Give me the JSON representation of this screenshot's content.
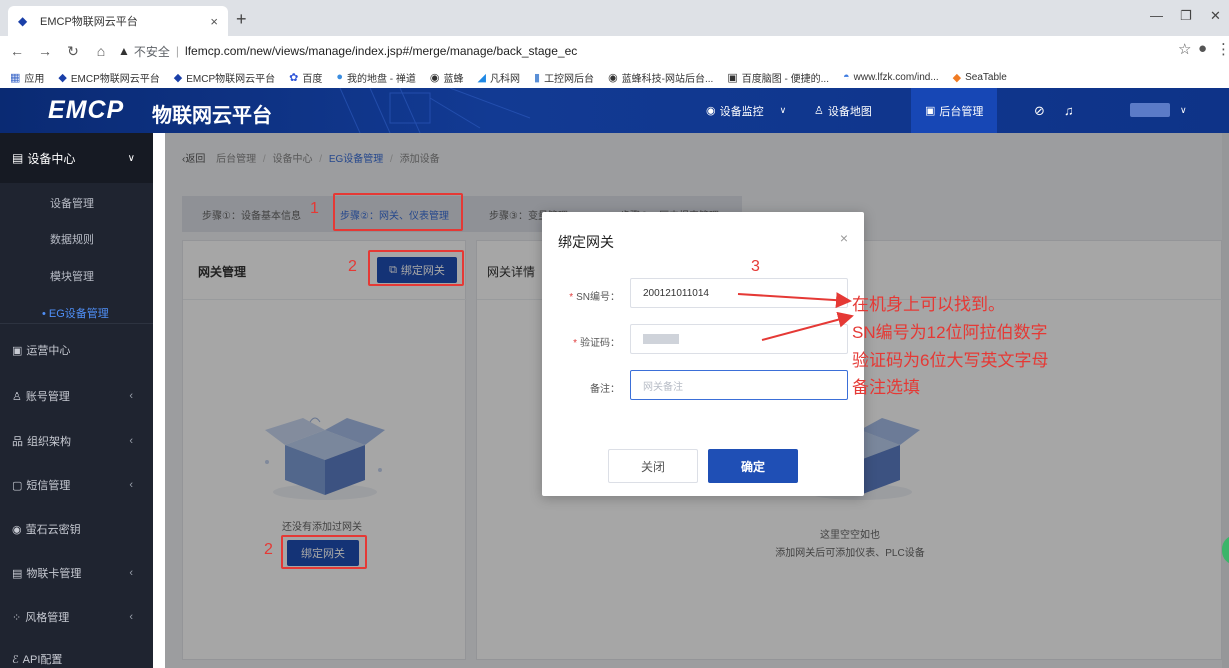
{
  "browser": {
    "tab_title": "EMCP物联网云平台",
    "tab_close": "×",
    "new_tab": "+",
    "insecure_label": "不安全",
    "url": "lfemcp.com/new/views/manage/index.jsp#/merge/manage/back_stage_ec",
    "bookmarks": [
      "应用",
      "EMCP物联网云平台",
      "EMCP物联网云平台",
      "百度",
      "我的地盘 - 禅道",
      "蓝蜂",
      "凡科网",
      "工控网后台",
      "蓝蜂科技-网站后台...",
      "百度脑图 - 便捷的...",
      "www.lfzk.com/ind...",
      "SeaTable"
    ]
  },
  "header": {
    "logo": "EMCP",
    "logo_sub": "物联网云平台",
    "nav": {
      "monitor": "设备监控",
      "monitor_caret": "∨",
      "map": "设备地图",
      "backend": "后台管理",
      "avatar_caret": "∨"
    }
  },
  "sidebar": {
    "head": "设备中心",
    "sub_items": [
      "设备管理",
      "数据规则",
      "模块管理",
      "EG设备管理"
    ],
    "items": [
      "运营中心",
      "账号管理",
      "组织架构",
      "短信管理",
      "萤石云密钥",
      "物联卡管理",
      "风格管理",
      "API配置"
    ]
  },
  "breadcrumb": {
    "back": "‹返回",
    "parts": [
      "后台管理",
      "设备中心",
      "EG设备管理",
      "添加设备"
    ]
  },
  "steps": [
    "步骤①：设备基本信息",
    "步骤②：网关、仪表管理",
    "步骤③：变量管理",
    "步骤④：历史报表管理"
  ],
  "panels": {
    "left_title": "网关管理",
    "bind_button": "绑定网关",
    "empty_text": "还没有添加过网关",
    "bind_button_2": "绑定网关",
    "right_title": "网关详情",
    "right_empty_1": "这里空空如也",
    "right_empty_2": "添加网关后可添加仪表、PLC设备"
  },
  "modal": {
    "title": "绑定网关",
    "close_icon": "×",
    "sn_label": "SN编号：",
    "sn_value": "200121011014",
    "code_label": "验证码：",
    "remark_label": "备注：",
    "remark_placeholder": "网关备注",
    "btn_close": "关闭",
    "btn_ok": "确定"
  },
  "annotations": {
    "n1": "1",
    "n2": "2",
    "n2b": "2",
    "n3": "3",
    "notes": [
      "在机身上可以找到。",
      "SN编号为12位阿拉伯数字",
      "验证码为6位大写英文字母",
      "备注选填"
    ]
  },
  "colors": {
    "header_bg": "#0a2a73",
    "sidebar_bg": "#1f2430",
    "primary": "#1f4fb5",
    "annotation": "#e53935"
  }
}
